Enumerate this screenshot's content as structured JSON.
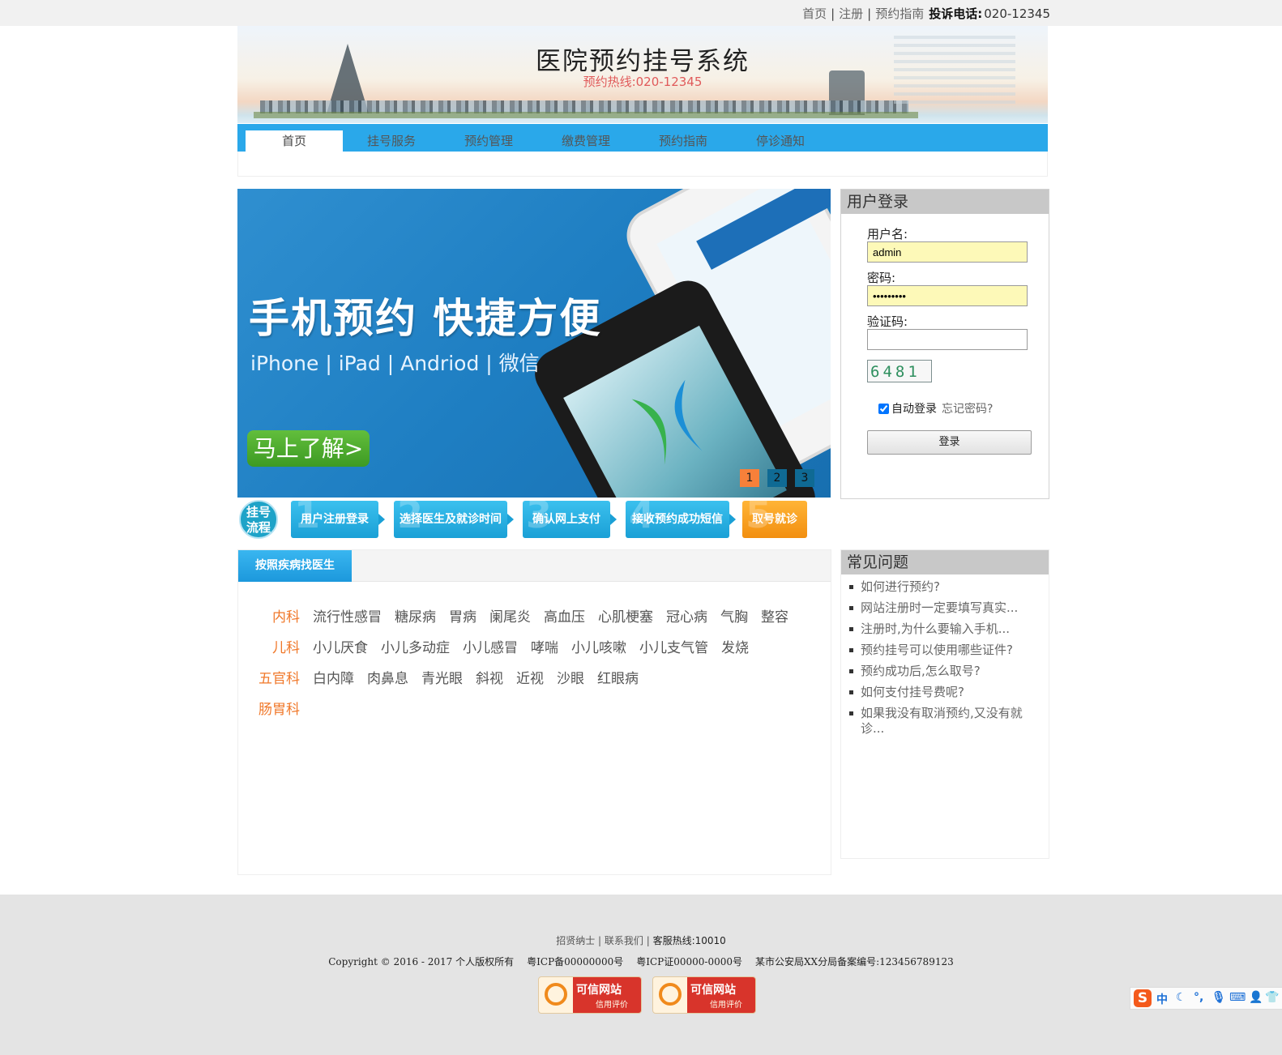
{
  "topbar": {
    "links": [
      "首页",
      "注册",
      "预约指南"
    ],
    "separator": "|",
    "phone_label": "投诉电话:",
    "phone_value": "020-12345"
  },
  "header": {
    "title": "医院预约挂号系统",
    "hotline": "预约热线:020-12345"
  },
  "nav": {
    "tabs": [
      "首页",
      "挂号服务",
      "预约管理",
      "缴费管理",
      "预约指南",
      "停诊通知"
    ],
    "active_index": 0
  },
  "banner": {
    "headline": "手机预约 快捷方便",
    "platforms": "iPhone | iPad | Andriod | 微信",
    "cta": "马上了解>",
    "slides": [
      "1",
      "2",
      "3"
    ],
    "active_slide": 1
  },
  "process": {
    "badge": "挂号\n流程",
    "steps": [
      {
        "num": "1",
        "label": "用户注册登录"
      },
      {
        "num": "2",
        "label": "选择医生及就诊时间"
      },
      {
        "num": "3",
        "label": "确认网上支付"
      },
      {
        "num": "4",
        "label": "接收预约成功短信"
      },
      {
        "num": "5",
        "label": "取号就诊"
      }
    ]
  },
  "disease": {
    "tab": "按照疾病找医生",
    "rows": [
      {
        "category": "内科",
        "items": [
          "流行性感冒",
          "糖尿病",
          "胃病",
          "阑尾炎",
          "高血压",
          "心肌梗塞",
          "冠心病",
          "气胸",
          "整容"
        ]
      },
      {
        "category": "儿科",
        "items": [
          "小儿厌食",
          "小儿多动症",
          "小儿感冒",
          "哮喘",
          "小儿咳嗽",
          "小儿支气管",
          "发烧"
        ]
      },
      {
        "category": "五官科",
        "items": [
          "白内障",
          "肉鼻息",
          "青光眼",
          "斜视",
          "近视",
          "沙眼",
          "红眼病"
        ]
      },
      {
        "category": "肠胃科",
        "items": []
      }
    ]
  },
  "login": {
    "title": "用户登录",
    "username_label": "用户名:",
    "username_value": "admin",
    "password_label": "密码:",
    "password_value": "123456789",
    "captcha_label": "验证码:",
    "captcha_value": "",
    "captcha_text": "6481",
    "remember_label": "自动登录",
    "remember_checked": true,
    "forgot": "忘记密码?",
    "submit": "登录"
  },
  "faq": {
    "title": "常见问题",
    "items": [
      "如何进行预约?",
      "网站注册时一定要填写真实...",
      "注册时,为什么要输入手机...",
      "预约挂号可以使用哪些证件?",
      "预约成功后,怎么取号?",
      "如何支付挂号费呢?",
      "如果我没有取消预约,又没有就诊..."
    ]
  },
  "footer": {
    "links": [
      "招贤纳士",
      "联系我们"
    ],
    "hotline": "客服热线:10010",
    "copyright": "Copyright © 2016 - 2017 个人版权所有",
    "icp1": "粤ICP备00000000号",
    "icp2": "粤ICP证00000-0000号",
    "police": "某市公安局XX分局备案编号:123456789123",
    "seal_title": "可信网站",
    "seal_sub": "信用评价"
  },
  "ime": {
    "logo": "S",
    "mode": "中"
  },
  "colors": {
    "nav_blue": "#2aa8ea",
    "category_orange": "#f0782a",
    "panel_gray": "#c8c8c8",
    "footer_gray": "#e4e4e4",
    "input_yellow": "#fdf9b8"
  }
}
